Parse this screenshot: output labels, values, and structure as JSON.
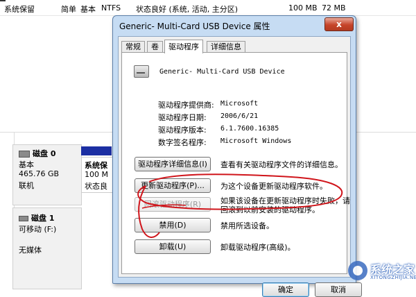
{
  "background": {
    "volume_row": {
      "name": "系统保留",
      "layout": "简单",
      "type": "基本",
      "fs": "NTFS",
      "status": "状态良好 (系统, 活动, 主分区)",
      "capacity": "100 MB",
      "free": "72 MB"
    },
    "disk0": {
      "label": "磁盘 0",
      "type": "基本",
      "size": "465.76 GB",
      "state": "联机",
      "volume_name": "系统保",
      "volume_size": "100 M",
      "volume_status": "状态良"
    },
    "disk1": {
      "label": "磁盘 1",
      "type": "可移动 (F:)",
      "media": "无媒体"
    }
  },
  "dialog": {
    "title": "Generic- Multi-Card USB Device 属性",
    "close_label": "x",
    "tabs": [
      {
        "label": "常规",
        "active": false
      },
      {
        "label": "卷",
        "active": false
      },
      {
        "label": "驱动程序",
        "active": true
      },
      {
        "label": "详细信息",
        "active": false
      }
    ],
    "device_name": "Generic- Multi-Card USB Device",
    "device_icon": "usb-card-reader-icon",
    "properties": [
      {
        "label": "驱动程序提供商:",
        "value": "Microsoft"
      },
      {
        "label": "驱动程序日期:",
        "value": "2006/6/21"
      },
      {
        "label": "驱动程序版本:",
        "value": "6.1.7600.16385"
      },
      {
        "label": "数字签名程序:",
        "value": "Microsoft Windows"
      }
    ],
    "actions": [
      {
        "button": "驱动程序详细信息(I)",
        "description": "查看有关驱动程序文件的详细信息。",
        "enabled": true
      },
      {
        "button": "更新驱动程序(P)...",
        "description": "为这个设备更新驱动程序软件。",
        "enabled": true
      },
      {
        "button": "回滚驱动程序(R)",
        "description": "如果该设备在更新驱动程序时失败，请回滚到以前安装的驱动程序。",
        "description_line1": "如果该设备在更新驱动程序时失败，请",
        "description_line2": "回滚到以前安装的驱动程序。",
        "enabled": false
      },
      {
        "button": "禁用(D)",
        "description": "禁用所选设备。",
        "enabled": true
      },
      {
        "button": "卸载(U)",
        "description": "卸载驱动程序(高级)。",
        "enabled": true
      }
    ],
    "ok_label": "确定",
    "cancel_label": "取消"
  },
  "watermark": {
    "text": "系统之家",
    "sub": "XITONGZHIJIA.NET"
  },
  "colors": {
    "dialog_frame": "#c6dcf3",
    "volume_header": "#1c2fa3",
    "close_button": "#c6442a",
    "annotation": "#d0151b"
  }
}
